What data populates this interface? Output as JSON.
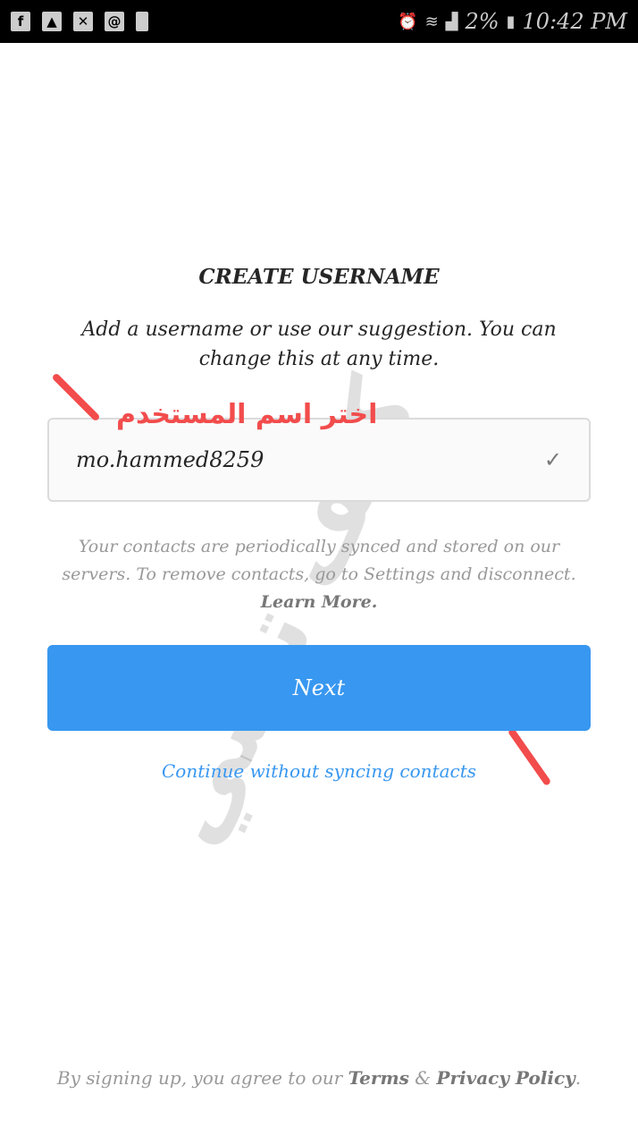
{
  "status_bar": {
    "icons_left": [
      "facebook-icon",
      "gallery-icon",
      "email-icon",
      "at-mail-icon",
      "screenshot-icon"
    ],
    "battery": "2%",
    "time": "10:42 PM"
  },
  "title": "CREATE USERNAME",
  "subtitle": "Add a username or use our suggestion. You can change this at any time.",
  "username": {
    "value": "mo.hammed8259",
    "valid": true
  },
  "annotation": "اختر اسم المستخدم",
  "contacts_text": "Your contacts are periodically synced and stored on our servers. To remove contacts, go to Settings and disconnect.",
  "learn_more": "Learn More.",
  "next_label": "Next",
  "continue_label": "Continue without syncing contacts",
  "footer": {
    "prefix": "By signing up, you agree to our",
    "terms": "Terms",
    "amp": "&",
    "privacy": "Privacy Policy",
    "suffix": "."
  },
  "watermark": "كيف تقني",
  "colors": {
    "accent": "#3897f0",
    "annotation": "#f24c4c"
  }
}
